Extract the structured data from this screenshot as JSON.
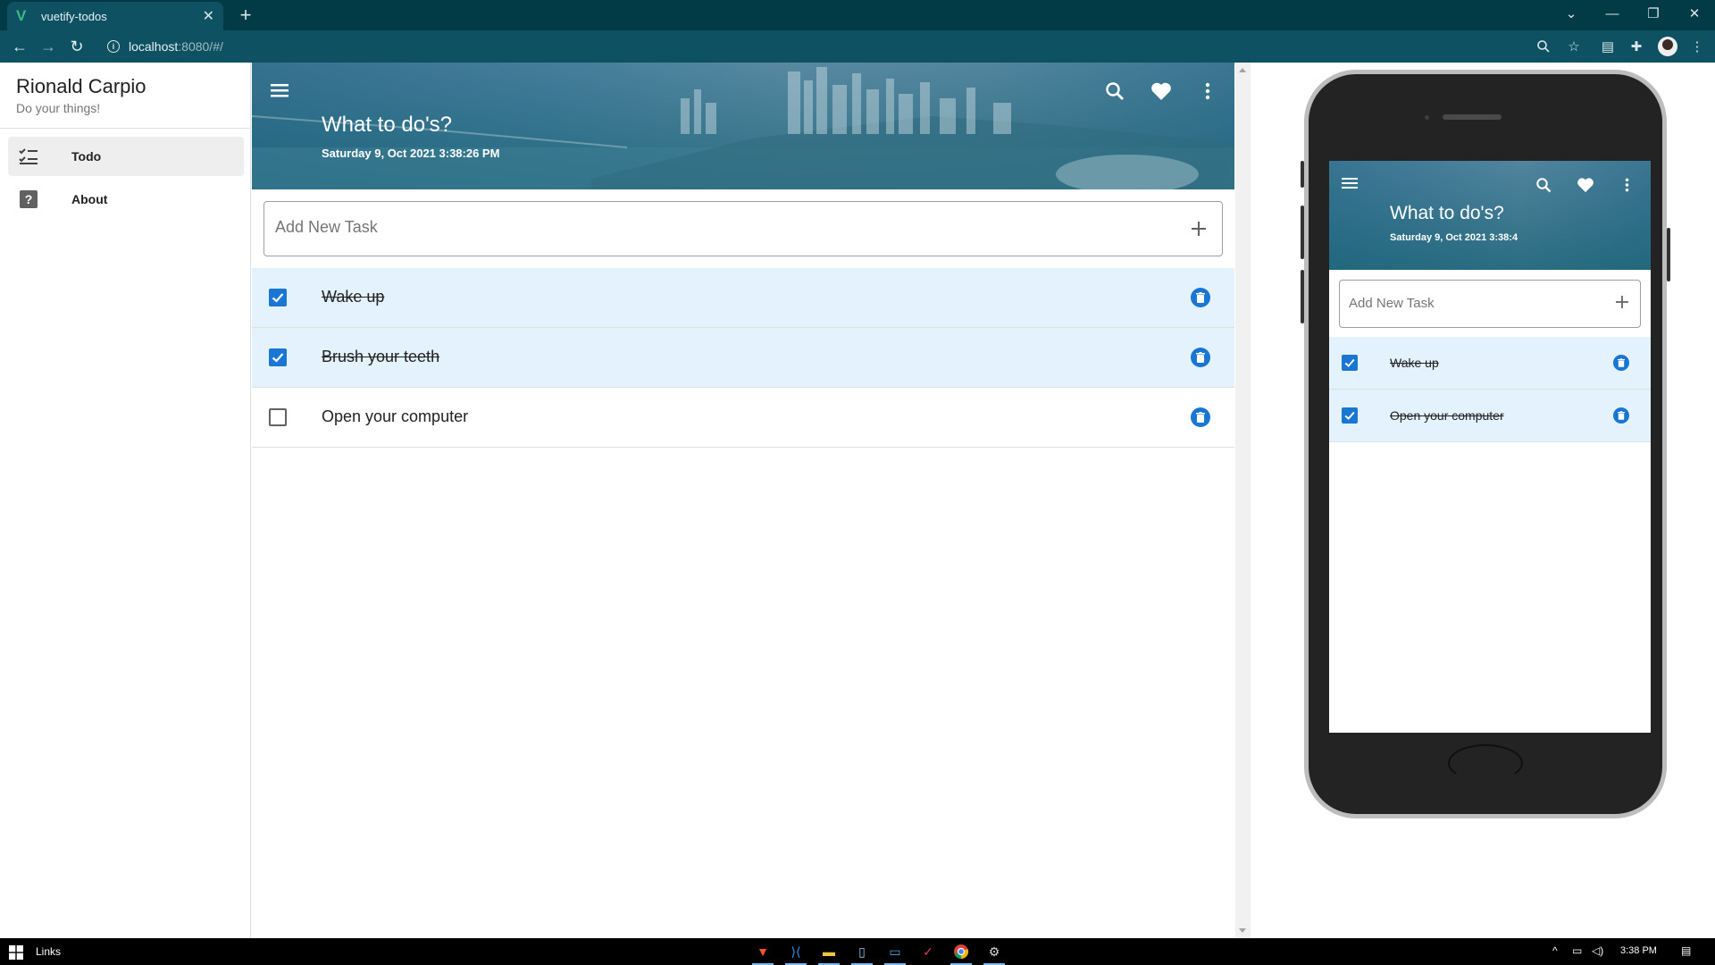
{
  "browser": {
    "tab_title": "vuetify-todos",
    "url_host": "localhost",
    "url_rest": ":8080/#/",
    "new_tab_icon": "plus-icon",
    "accent": "#023a45",
    "toolbar_color": "#0d5162"
  },
  "drawer": {
    "user_name": "Rionald Carpio",
    "user_subtitle": "Do your things!",
    "items": [
      {
        "label": "Todo",
        "icon": "checklist-icon",
        "active": true
      },
      {
        "label": "About",
        "icon": "help-icon",
        "active": false
      }
    ]
  },
  "app": {
    "title": "What to do's?",
    "datetime": "Saturday 9, Oct 2021 3:38:26 PM",
    "add_placeholder": "Add New Task",
    "accent": "#1976d2",
    "done_row_color": "#e3f2fd",
    "tasks": [
      {
        "text": "Wake up",
        "done": true
      },
      {
        "text": "Brush your teeth",
        "done": true
      },
      {
        "text": "Open your computer",
        "done": false
      }
    ]
  },
  "phone": {
    "title": "What to do's?",
    "datetime": "Saturday 9, Oct 2021 3:38:4",
    "add_placeholder": "Add New Task",
    "tasks": [
      {
        "text": "Wake up",
        "done": true
      },
      {
        "text": "Open your computer",
        "done": true
      }
    ]
  },
  "taskbar": {
    "links_label": "Links",
    "clock": "3:38 PM"
  }
}
